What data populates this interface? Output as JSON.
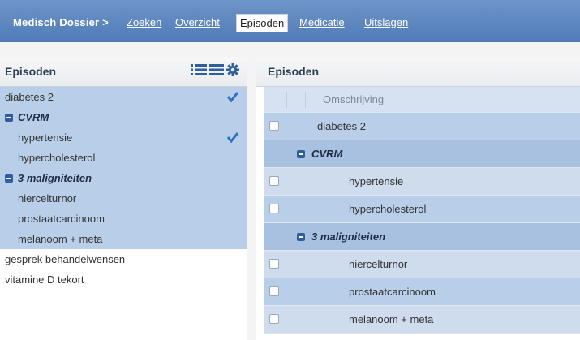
{
  "nav": {
    "brand": "Medisch Dossier >",
    "items": [
      {
        "label": "Zoeken",
        "active": false
      },
      {
        "label": "Overzicht",
        "active": false
      },
      {
        "label": "Episoden",
        "active": true
      },
      {
        "label": "Medicatie",
        "active": false
      },
      {
        "label": "Uitslagen",
        "active": false
      }
    ]
  },
  "left_panel": {
    "title": "Episoden",
    "icons": [
      "list-icon",
      "menu-icon",
      "gear-icon"
    ],
    "rows": [
      {
        "label": "diabetes 2",
        "type": "item",
        "selected": true,
        "checked": true
      },
      {
        "label": "CVRM",
        "type": "group",
        "selected": true
      },
      {
        "label": "hypertensie",
        "type": "child",
        "selected": true,
        "checked": true
      },
      {
        "label": "hypercholesterol",
        "type": "child",
        "selected": true
      },
      {
        "label": "3 maligniteiten",
        "type": "group",
        "selected": true
      },
      {
        "label": "niercelturnor",
        "type": "item",
        "selected": true
      },
      {
        "label": "prostaatcarcinoom",
        "type": "item",
        "selected": true
      },
      {
        "label": "melanoom + meta",
        "type": "item",
        "selected": true
      },
      {
        "label": "gesprek behandelwensen",
        "type": "item",
        "selected": false
      },
      {
        "label": "vitamine D tekort",
        "type": "item",
        "selected": false
      }
    ]
  },
  "right_panel": {
    "title": "Episoden",
    "column_header": "Omschrijving",
    "rows": [
      {
        "label": "diabetes 2",
        "type": "item"
      },
      {
        "label": "CVRM",
        "type": "group"
      },
      {
        "label": "hypertensie",
        "type": "child"
      },
      {
        "label": "hypercholesterol",
        "type": "child"
      },
      {
        "label": "3 maligniteiten",
        "type": "group"
      },
      {
        "label": "niercelturnor",
        "type": "child"
      },
      {
        "label": "prostaatcarcinoom",
        "type": "child"
      },
      {
        "label": "melanoom + meta",
        "type": "child"
      }
    ]
  },
  "colors": {
    "nav_bg": "#5a84bd",
    "selected_row": "#b9cee8",
    "check": "#2f6fc4"
  }
}
